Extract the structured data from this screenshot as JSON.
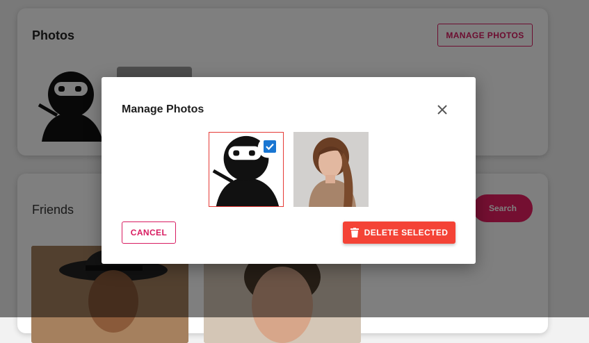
{
  "photos_card": {
    "title": "Photos",
    "manage_button": "MANAGE PHOTOS"
  },
  "friends_card": {
    "title": "Friends",
    "search_button": "Search"
  },
  "dialog": {
    "title": "Manage Photos",
    "photos": [
      {
        "name": "ninja-avatar",
        "selected": true
      },
      {
        "name": "woman-portrait",
        "selected": false
      }
    ],
    "cancel_button": "CANCEL",
    "delete_button": "DELETE SELECTED"
  },
  "colors": {
    "accent": "#e91e63",
    "danger": "#f44336",
    "checkbox": "#1976d2"
  }
}
